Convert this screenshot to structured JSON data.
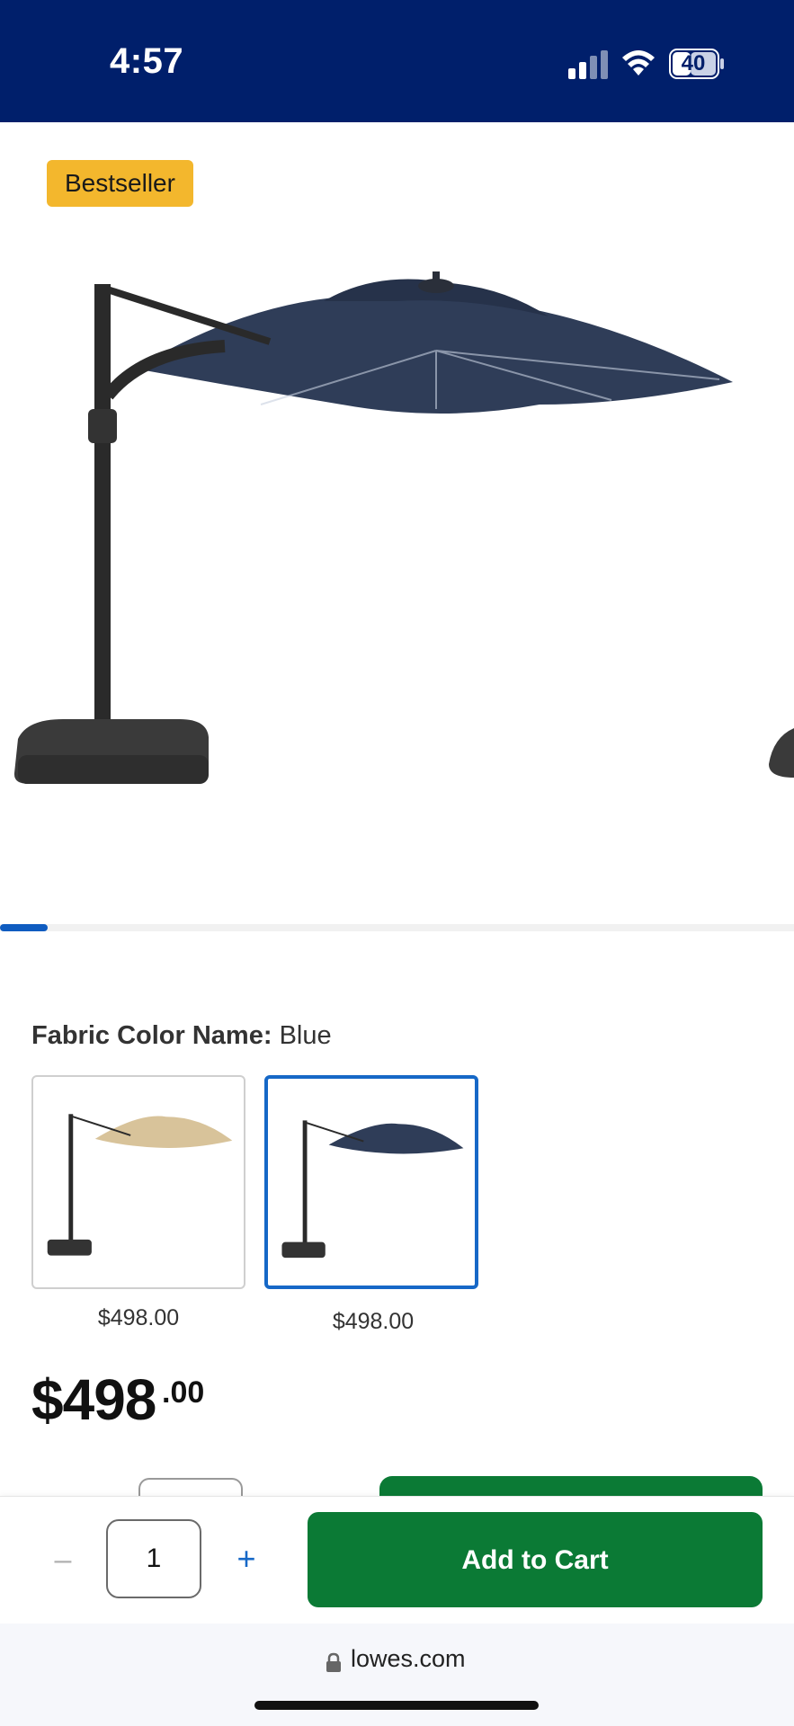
{
  "status_bar": {
    "time": "4:57",
    "battery_level": "40",
    "icons": [
      "signal-icon",
      "wifi-icon",
      "battery-icon"
    ],
    "background_color": "#001f6b"
  },
  "product": {
    "badge": "Bestseller",
    "image_icon": "patio-umbrella-image",
    "carousel_progress": 0.06
  },
  "options": {
    "label": "Fabric Color Name:",
    "selected_value": "Blue",
    "swatches": [
      {
        "color": "Tan",
        "price": "$498.00",
        "selected": false,
        "canopy_color": "#d8c39a"
      },
      {
        "color": "Blue",
        "price": "$498.00",
        "selected": true,
        "canopy_color": "#2f3d58"
      }
    ]
  },
  "price": {
    "dollars": "$498",
    "cents": ".00"
  },
  "purchase": {
    "minus_label": "–",
    "quantity": "1",
    "plus_label": "+",
    "add_to_cart_label": "Add to Cart",
    "accent_color": "#0b7a35"
  },
  "browser": {
    "url": "lowes.com",
    "lock_icon": "lock-icon"
  }
}
